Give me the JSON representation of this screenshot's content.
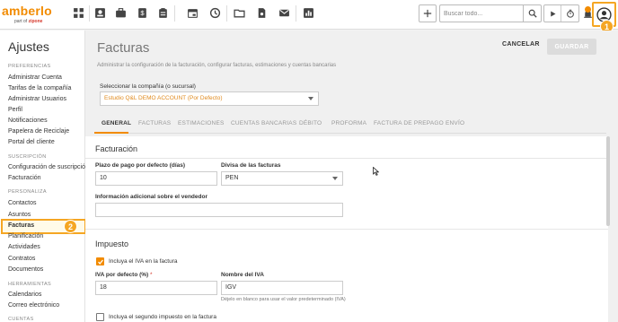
{
  "header": {
    "logo_text": "amberlo",
    "logo_sub_prefix": "part of",
    "logo_sub_brand": "zipone",
    "search_placeholder": "Buscar todo...",
    "nav_icons": [
      "dashboard-icon",
      "contacts-icon",
      "briefcase-icon",
      "billing-icon",
      "clipboard-icon",
      "calendar-icon",
      "history-icon",
      "folder-icon",
      "document-icon",
      "mail-icon",
      "reports-icon"
    ],
    "step1": "1"
  },
  "sidebar": {
    "title": "Ajustes",
    "sections": [
      {
        "label": "PREFERENCIAS",
        "items": [
          "Administrar Cuenta",
          "Tarifas de la compañía",
          "Administrar Usuarios",
          "Perfil",
          "Notificaciones",
          "Papelera de Reciclaje",
          "Portal del cliente"
        ]
      },
      {
        "label": "SUSCRIPCIÓN",
        "items": [
          "Configuración de suscripción",
          "Facturación"
        ]
      },
      {
        "label": "PERSONALIZA",
        "items": [
          "Contactos",
          "Asuntos",
          "Facturas",
          "Planificación",
          "Actividades",
          "Contratos",
          "Documentos"
        ]
      },
      {
        "label": "HERRAMIENTAS",
        "items": [
          "Calendarios",
          "Correo electrónico"
        ]
      },
      {
        "label": "CUENTAS",
        "items": []
      }
    ],
    "active_item": "Facturas",
    "step2": "2"
  },
  "main": {
    "title": "Facturas",
    "description": "Administrar la configuración de la facturación, configurar facturas, estimaciones y cuentas bancarias",
    "cancel_label": "CANCELAR",
    "save_label": "GUARDAR",
    "company_label": "Seleccionar la compañía (o sucursal)",
    "company_value": "Estudio Q&L DEMO ACCOUNT (Por Defecto)",
    "tabs": [
      "GENERAL",
      "FACTURAS",
      "ESTIMACIONES",
      "CUENTAS BANCARIAS",
      "DÉBITO",
      "PROFORMA",
      "FACTURA DE PREPAGO",
      "ENVÍO"
    ],
    "active_tab": "GENERAL",
    "billing": {
      "section_title": "Facturación",
      "payment_term_label": "Plazo de pago por defecto (días)",
      "payment_term_value": "10",
      "currency_label": "Divisa de las facturas",
      "currency_value": "PEN",
      "vendor_info_label": "Información adicional sobre el vendedor",
      "vendor_info_value": ""
    },
    "tax": {
      "section_title": "Impuesto",
      "include_vat_label": "Incluya el IVA en la factura",
      "include_vat_checked": true,
      "vat_default_label": "IVA por defecto (%)",
      "vat_default_required": "*",
      "vat_default_value": "18",
      "vat_name_label": "Nombre del IVA",
      "vat_name_value": "IGV",
      "vat_name_hint": "Déjelo en blanco para usar el valor predeterminado (IVA)",
      "second_tax_label": "Incluya el segundo impuesto en la factura",
      "second_tax_checked": false
    }
  },
  "colors": {
    "brand_orange": "#f28b00",
    "highlight_yellow": "#f5a623",
    "required_red": "#d63a2e"
  }
}
